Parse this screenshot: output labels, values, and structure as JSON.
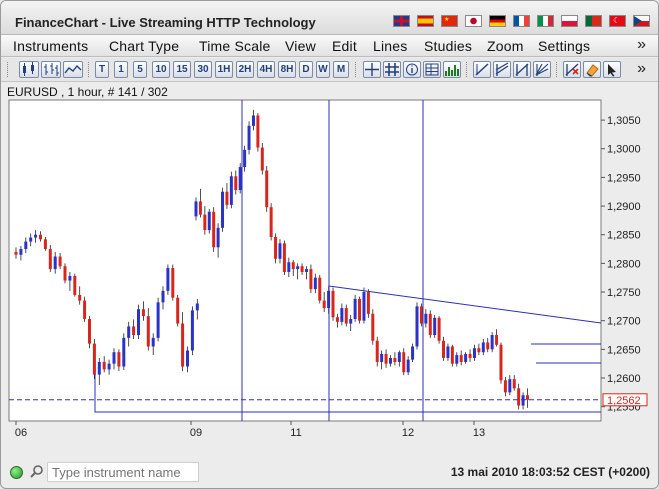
{
  "window": {
    "title": "FinanceChart - Live Streaming HTTP Technology",
    "language_flags": [
      "flag-uk-icon",
      "flag-spain-icon",
      "flag-china-icon",
      "flag-japan-icon",
      "flag-germany-icon",
      "flag-france-icon",
      "flag-italy-icon",
      "flag-poland-icon",
      "flag-portugal-icon",
      "flag-turkey-icon",
      "flag-czech-icon"
    ]
  },
  "menu": {
    "items": [
      "Instruments",
      "Chart Type",
      "Time Scale",
      "View",
      "Edit",
      "Lines",
      "Studies",
      "Zoom",
      "Settings"
    ],
    "overflow": "»"
  },
  "toolbar": {
    "timescale_labels": [
      "T",
      "1",
      "5",
      "10",
      "15",
      "30",
      "1H",
      "2H",
      "4H",
      "8H",
      "D",
      "W",
      "M"
    ],
    "overflow": "»"
  },
  "chart_header": "EURUSD , 1 hour, # 141 / 302",
  "chart_data": {
    "type": "candlestick",
    "instrument": "EURUSD",
    "interval": "1 hour",
    "x_tick_labels": [
      "06",
      "09",
      "11",
      "12",
      "13"
    ],
    "y_tick_labels": [
      "1,2550",
      "1,2600",
      "1,2650",
      "1,2700",
      "1,2750",
      "1,2800",
      "1,2850",
      "1,2900",
      "1,2950",
      "1,3000",
      "1,3050"
    ],
    "ylim": [
      1.2525,
      1.3085
    ],
    "current_price_label": "1,2562",
    "current_price": 1.2562,
    "series": [
      {
        "name": "bars",
        "values": [
          [
            1.282,
            1.2828,
            1.2808,
            1.2815
          ],
          [
            1.2815,
            1.283,
            1.2805,
            1.2825
          ],
          [
            1.2825,
            1.2845,
            1.2818,
            1.2838
          ],
          [
            1.2838,
            1.2852,
            1.283,
            1.2845
          ],
          [
            1.2845,
            1.2858,
            1.2836,
            1.285
          ],
          [
            1.285,
            1.2856,
            1.2838,
            1.2842
          ],
          [
            1.2842,
            1.2846,
            1.2822,
            1.2825
          ],
          [
            1.2825,
            1.2832,
            1.2785,
            1.279
          ],
          [
            1.279,
            1.282,
            1.2782,
            1.2812
          ],
          [
            1.2812,
            1.2818,
            1.279,
            1.2795
          ],
          [
            1.2795,
            1.28,
            1.2765,
            1.277
          ],
          [
            1.277,
            1.2785,
            1.2752,
            1.2778
          ],
          [
            1.2778,
            1.2782,
            1.2742,
            1.2745
          ],
          [
            1.2745,
            1.276,
            1.2728,
            1.2735
          ],
          [
            1.2735,
            1.2742,
            1.2698,
            1.2703
          ],
          [
            1.2703,
            1.2708,
            1.2652,
            1.266
          ],
          [
            1.266,
            1.2668,
            1.2598,
            1.2606
          ],
          [
            1.2606,
            1.2635,
            1.2588,
            1.2628
          ],
          [
            1.2628,
            1.2638,
            1.261,
            1.2615
          ],
          [
            1.2615,
            1.2632,
            1.2606,
            1.2625
          ],
          [
            1.2625,
            1.2652,
            1.2615,
            1.2645
          ],
          [
            1.2645,
            1.265,
            1.2612,
            1.262
          ],
          [
            1.262,
            1.2678,
            1.2614,
            1.267
          ],
          [
            1.267,
            1.2698,
            1.2655,
            1.269
          ],
          [
            1.269,
            1.2702,
            1.2668,
            1.2675
          ],
          [
            1.2675,
            1.2728,
            1.2668,
            1.272
          ],
          [
            1.272,
            1.2734,
            1.27,
            1.2708
          ],
          [
            1.2708,
            1.2722,
            1.2648,
            1.2655
          ],
          [
            1.2655,
            1.2678,
            1.264,
            1.267
          ],
          [
            1.267,
            1.274,
            1.2664,
            1.2732
          ],
          [
            1.2732,
            1.276,
            1.272,
            1.2752
          ],
          [
            1.2752,
            1.2798,
            1.2745,
            1.2792
          ],
          [
            1.2792,
            1.2798,
            1.2735,
            1.274
          ],
          [
            1.274,
            1.2745,
            1.269,
            1.2695
          ],
          [
            1.2695,
            1.2715,
            1.2612,
            1.262
          ],
          [
            1.262,
            1.2655,
            1.261,
            1.2648
          ],
          [
            1.2648,
            1.2725,
            1.264,
            1.2718
          ],
          [
            1.2718,
            1.2738,
            1.2702,
            1.273
          ],
          [
            1.2882,
            1.2915,
            1.2875,
            1.2908
          ],
          [
            1.2908,
            1.293,
            1.288,
            1.2885
          ],
          [
            1.2885,
            1.29,
            1.285,
            1.2858
          ],
          [
            1.2858,
            1.2895,
            1.2852,
            1.289
          ],
          [
            1.289,
            1.2898,
            1.282,
            1.2828
          ],
          [
            1.2828,
            1.287,
            1.281,
            1.2862
          ],
          [
            1.2862,
            1.2932,
            1.2855,
            1.2925
          ],
          [
            1.2925,
            1.294,
            1.2895,
            1.2902
          ],
          [
            1.2902,
            1.296,
            1.2896,
            1.2952
          ],
          [
            1.2952,
            1.2962,
            1.292,
            1.2928
          ],
          [
            1.2928,
            1.2975,
            1.2922,
            1.2968
          ],
          [
            1.2968,
            1.3005,
            1.296,
            1.2998
          ],
          [
            1.2998,
            1.3048,
            1.299,
            1.304
          ],
          [
            1.304,
            1.3068,
            1.3032,
            1.3058
          ],
          [
            1.3058,
            1.3062,
            1.2995,
            1.3002
          ],
          [
            1.3002,
            1.301,
            1.2955,
            1.2962
          ],
          [
            1.2962,
            1.297,
            1.289,
            1.2898
          ],
          [
            1.2898,
            1.2905,
            1.284,
            1.2846
          ],
          [
            1.2846,
            1.2852,
            1.28,
            1.2808
          ],
          [
            1.2808,
            1.2842,
            1.28,
            1.2835
          ],
          [
            1.2835,
            1.284,
            1.278,
            1.2785
          ],
          [
            1.2785,
            1.281,
            1.2776,
            1.2802
          ],
          [
            1.2802,
            1.2806,
            1.2778,
            1.279
          ],
          [
            1.279,
            1.28,
            1.2772,
            1.2795
          ],
          [
            1.2795,
            1.28,
            1.278,
            1.2785
          ],
          [
            1.2785,
            1.2795,
            1.2772,
            1.279
          ],
          [
            1.279,
            1.2798,
            1.2748,
            1.2755
          ],
          [
            1.2755,
            1.2782,
            1.2748,
            1.2775
          ],
          [
            1.2775,
            1.278,
            1.273,
            1.2735
          ],
          [
            1.2735,
            1.275,
            1.2715,
            1.2722
          ],
          [
            1.2722,
            1.276,
            1.2712,
            1.2752
          ],
          [
            1.2752,
            1.2758,
            1.27,
            1.2706
          ],
          [
            1.2706,
            1.2712,
            1.2688,
            1.2698
          ],
          [
            1.2698,
            1.273,
            1.2692,
            1.2722
          ],
          [
            1.2722,
            1.2728,
            1.269,
            1.2695
          ],
          [
            1.2695,
            1.271,
            1.2682,
            1.2703
          ],
          [
            1.2703,
            1.2745,
            1.2698,
            1.2738
          ],
          [
            1.2738,
            1.2742,
            1.2695,
            1.27
          ],
          [
            1.27,
            1.2758,
            1.2695,
            1.275
          ],
          [
            1.275,
            1.2755,
            1.2705,
            1.2712
          ],
          [
            1.2712,
            1.272,
            1.2658,
            1.2665
          ],
          [
            1.2665,
            1.2672,
            1.262,
            1.2628
          ],
          [
            1.2628,
            1.2648,
            1.2615,
            1.2642
          ],
          [
            1.2642,
            1.265,
            1.2618,
            1.2625
          ],
          [
            1.2625,
            1.264,
            1.262,
            1.2635
          ],
          [
            1.2635,
            1.2645,
            1.2622,
            1.2628
          ],
          [
            1.2628,
            1.2648,
            1.262,
            1.2645
          ],
          [
            1.2645,
            1.2652,
            1.2605,
            1.261
          ],
          [
            1.261,
            1.2638,
            1.2605,
            1.2632
          ],
          [
            1.2632,
            1.266,
            1.2628,
            1.2655
          ],
          [
            1.2655,
            1.2732,
            1.265,
            1.2725
          ],
          [
            1.2725,
            1.273,
            1.269,
            1.2695
          ],
          [
            1.2695,
            1.272,
            1.2688,
            1.2712
          ],
          [
            1.2712,
            1.2718,
            1.267,
            1.2675
          ],
          [
            1.2675,
            1.271,
            1.267,
            1.2705
          ],
          [
            1.2705,
            1.2708,
            1.266,
            1.2665
          ],
          [
            1.2665,
            1.2672,
            1.263,
            1.2635
          ],
          [
            1.2635,
            1.266,
            1.263,
            1.2655
          ],
          [
            1.2655,
            1.2658,
            1.262,
            1.2625
          ],
          [
            1.2625,
            1.2645,
            1.262,
            1.264
          ],
          [
            1.264,
            1.2648,
            1.2622,
            1.2628
          ],
          [
            1.2628,
            1.2645,
            1.2625,
            1.2642
          ],
          [
            1.2642,
            1.265,
            1.2628,
            1.2635
          ],
          [
            1.2635,
            1.2658,
            1.263,
            1.2652
          ],
          [
            1.2652,
            1.266,
            1.264,
            1.2645
          ],
          [
            1.2645,
            1.2668,
            1.264,
            1.2662
          ],
          [
            1.2662,
            1.267,
            1.2645,
            1.265
          ],
          [
            1.265,
            1.268,
            1.2645,
            1.2675
          ],
          [
            1.2675,
            1.2685,
            1.2655,
            1.2658
          ],
          [
            1.2658,
            1.2662,
            1.259,
            1.2596
          ],
          [
            1.2596,
            1.2602,
            1.2568,
            1.2575
          ],
          [
            1.2575,
            1.2605,
            1.257,
            1.2598
          ],
          [
            1.2598,
            1.2605,
            1.2578,
            1.2582
          ],
          [
            1.2582,
            1.259,
            1.2545,
            1.2552
          ],
          [
            1.2552,
            1.2575,
            1.2545,
            1.257
          ],
          [
            1.257,
            1.2582,
            1.2548,
            1.2562
          ]
        ]
      }
    ],
    "colors": {
      "up": "#2a33c9",
      "down": "#d9261c",
      "lines": "#2b2fb8",
      "current_price_label": "#d9261c"
    },
    "grid": false
  },
  "status": {
    "search_placeholder": "Type instrument name",
    "datetime": "13 mai 2010 18:03:52  CEST (+0200)"
  }
}
